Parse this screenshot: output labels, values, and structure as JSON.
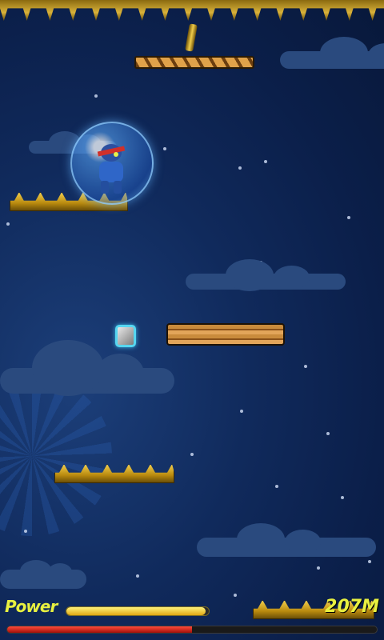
{
  "hud": {
    "power_label": "Power",
    "power_level": 0.98,
    "distance": "207M",
    "progress_level": 0.5
  },
  "colors": {
    "hud_text": "#e8f040",
    "progress": "#d0201a",
    "sky": "#0b1f4a"
  },
  "icons": {
    "player": "ninja-in-bubble-icon",
    "powerup": "stone-block-icon"
  }
}
